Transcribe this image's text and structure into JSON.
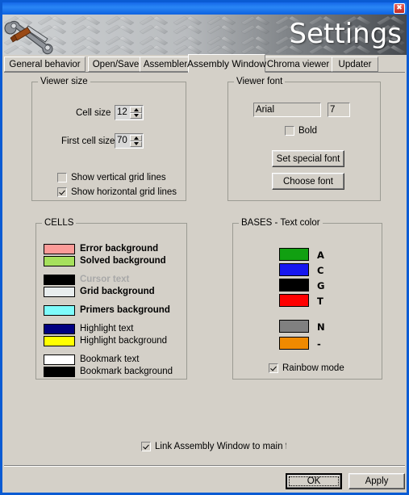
{
  "window": {
    "title": "Settings",
    "close_label": "✖"
  },
  "tabs": [
    {
      "label": "General behavior",
      "selected": false
    },
    {
      "label": "Open/Save",
      "selected": false
    },
    {
      "label": "Assembler",
      "selected": false
    },
    {
      "label": "Assembly Window",
      "selected": true
    },
    {
      "label": "Chroma viewer",
      "selected": false
    },
    {
      "label": "Updater",
      "selected": false
    }
  ],
  "viewer_size": {
    "title": "Viewer size",
    "cell_size_label": "Cell size",
    "cell_size_value": "12",
    "first_cell_size_label": "First cell size",
    "first_cell_size_value": "70",
    "show_vertical_label": "Show vertical grid lines",
    "show_vertical_checked": false,
    "show_horizontal_label": "Show horizontal grid lines",
    "show_horizontal_checked": true
  },
  "viewer_font": {
    "title": "Viewer font",
    "font_name": "Arial",
    "font_size": "7",
    "bold_label": "Bold",
    "bold_checked": false,
    "set_special_font_label": "Set special font",
    "choose_font_label": "Choose font"
  },
  "cells": {
    "title": "CELLS",
    "rows": [
      {
        "label": "Error background",
        "color": "#fb9b98",
        "style": "bold"
      },
      {
        "label": "Solved background",
        "color": "#a6e05c",
        "style": "bold"
      },
      {
        "label": "Cursor text",
        "color": "#000000",
        "style": "gray"
      },
      {
        "label": "Grid background",
        "color": "#e8edee",
        "style": "bold"
      },
      {
        "label": "Primers background",
        "color": "#7efbfb",
        "style": "bold"
      },
      {
        "label": "Highlight text",
        "color": "#000080",
        "style": "normal"
      },
      {
        "label": "Highlight background",
        "color": "#ffff00",
        "style": "normal"
      },
      {
        "label": "Bookmark text",
        "color": "#ffffff",
        "style": "normal"
      },
      {
        "label": "Bookmark background",
        "color": "#000000",
        "style": "normal"
      }
    ]
  },
  "bases": {
    "title": "BASES - Text color",
    "rows": [
      {
        "label": "A",
        "color": "#11a011"
      },
      {
        "label": "C",
        "color": "#1616f0"
      },
      {
        "label": "G",
        "color": "#000000"
      },
      {
        "label": "T",
        "color": "#ff0000"
      },
      {
        "label": "N",
        "color": "#808080"
      },
      {
        "label": "-",
        "color": "#f08a00"
      }
    ],
    "rainbow_label": "Rainbow mode",
    "rainbow_checked": true
  },
  "footer": {
    "link_label": "Link Assembly Window to main form's ",
    "link_checked": true,
    "ok_label": "OK",
    "apply_label": "Apply"
  }
}
